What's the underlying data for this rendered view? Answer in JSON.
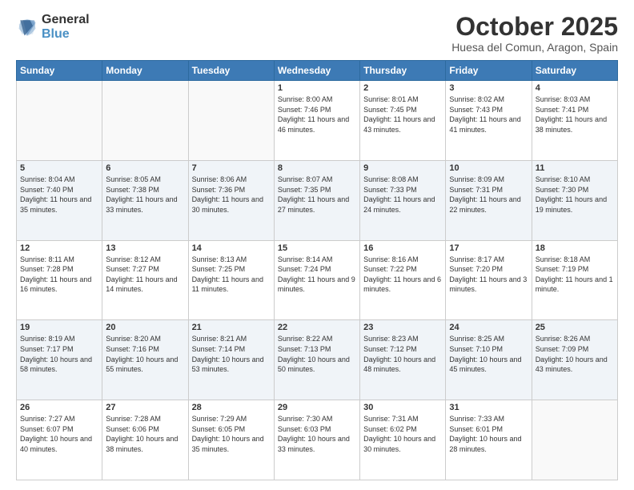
{
  "logo": {
    "general": "General",
    "blue": "Blue"
  },
  "header": {
    "title": "October 2025",
    "subtitle": "Huesa del Comun, Aragon, Spain"
  },
  "weekdays": [
    "Sunday",
    "Monday",
    "Tuesday",
    "Wednesday",
    "Thursday",
    "Friday",
    "Saturday"
  ],
  "weeks": [
    [
      {
        "day": "",
        "sunrise": "",
        "sunset": "",
        "daylight": ""
      },
      {
        "day": "",
        "sunrise": "",
        "sunset": "",
        "daylight": ""
      },
      {
        "day": "",
        "sunrise": "",
        "sunset": "",
        "daylight": ""
      },
      {
        "day": "1",
        "sunrise": "Sunrise: 8:00 AM",
        "sunset": "Sunset: 7:46 PM",
        "daylight": "Daylight: 11 hours and 46 minutes."
      },
      {
        "day": "2",
        "sunrise": "Sunrise: 8:01 AM",
        "sunset": "Sunset: 7:45 PM",
        "daylight": "Daylight: 11 hours and 43 minutes."
      },
      {
        "day": "3",
        "sunrise": "Sunrise: 8:02 AM",
        "sunset": "Sunset: 7:43 PM",
        "daylight": "Daylight: 11 hours and 41 minutes."
      },
      {
        "day": "4",
        "sunrise": "Sunrise: 8:03 AM",
        "sunset": "Sunset: 7:41 PM",
        "daylight": "Daylight: 11 hours and 38 minutes."
      }
    ],
    [
      {
        "day": "5",
        "sunrise": "Sunrise: 8:04 AM",
        "sunset": "Sunset: 7:40 PM",
        "daylight": "Daylight: 11 hours and 35 minutes."
      },
      {
        "day": "6",
        "sunrise": "Sunrise: 8:05 AM",
        "sunset": "Sunset: 7:38 PM",
        "daylight": "Daylight: 11 hours and 33 minutes."
      },
      {
        "day": "7",
        "sunrise": "Sunrise: 8:06 AM",
        "sunset": "Sunset: 7:36 PM",
        "daylight": "Daylight: 11 hours and 30 minutes."
      },
      {
        "day": "8",
        "sunrise": "Sunrise: 8:07 AM",
        "sunset": "Sunset: 7:35 PM",
        "daylight": "Daylight: 11 hours and 27 minutes."
      },
      {
        "day": "9",
        "sunrise": "Sunrise: 8:08 AM",
        "sunset": "Sunset: 7:33 PM",
        "daylight": "Daylight: 11 hours and 24 minutes."
      },
      {
        "day": "10",
        "sunrise": "Sunrise: 8:09 AM",
        "sunset": "Sunset: 7:31 PM",
        "daylight": "Daylight: 11 hours and 22 minutes."
      },
      {
        "day": "11",
        "sunrise": "Sunrise: 8:10 AM",
        "sunset": "Sunset: 7:30 PM",
        "daylight": "Daylight: 11 hours and 19 minutes."
      }
    ],
    [
      {
        "day": "12",
        "sunrise": "Sunrise: 8:11 AM",
        "sunset": "Sunset: 7:28 PM",
        "daylight": "Daylight: 11 hours and 16 minutes."
      },
      {
        "day": "13",
        "sunrise": "Sunrise: 8:12 AM",
        "sunset": "Sunset: 7:27 PM",
        "daylight": "Daylight: 11 hours and 14 minutes."
      },
      {
        "day": "14",
        "sunrise": "Sunrise: 8:13 AM",
        "sunset": "Sunset: 7:25 PM",
        "daylight": "Daylight: 11 hours and 11 minutes."
      },
      {
        "day": "15",
        "sunrise": "Sunrise: 8:14 AM",
        "sunset": "Sunset: 7:24 PM",
        "daylight": "Daylight: 11 hours and 9 minutes."
      },
      {
        "day": "16",
        "sunrise": "Sunrise: 8:16 AM",
        "sunset": "Sunset: 7:22 PM",
        "daylight": "Daylight: 11 hours and 6 minutes."
      },
      {
        "day": "17",
        "sunrise": "Sunrise: 8:17 AM",
        "sunset": "Sunset: 7:20 PM",
        "daylight": "Daylight: 11 hours and 3 minutes."
      },
      {
        "day": "18",
        "sunrise": "Sunrise: 8:18 AM",
        "sunset": "Sunset: 7:19 PM",
        "daylight": "Daylight: 11 hours and 1 minute."
      }
    ],
    [
      {
        "day": "19",
        "sunrise": "Sunrise: 8:19 AM",
        "sunset": "Sunset: 7:17 PM",
        "daylight": "Daylight: 10 hours and 58 minutes."
      },
      {
        "day": "20",
        "sunrise": "Sunrise: 8:20 AM",
        "sunset": "Sunset: 7:16 PM",
        "daylight": "Daylight: 10 hours and 55 minutes."
      },
      {
        "day": "21",
        "sunrise": "Sunrise: 8:21 AM",
        "sunset": "Sunset: 7:14 PM",
        "daylight": "Daylight: 10 hours and 53 minutes."
      },
      {
        "day": "22",
        "sunrise": "Sunrise: 8:22 AM",
        "sunset": "Sunset: 7:13 PM",
        "daylight": "Daylight: 10 hours and 50 minutes."
      },
      {
        "day": "23",
        "sunrise": "Sunrise: 8:23 AM",
        "sunset": "Sunset: 7:12 PM",
        "daylight": "Daylight: 10 hours and 48 minutes."
      },
      {
        "day": "24",
        "sunrise": "Sunrise: 8:25 AM",
        "sunset": "Sunset: 7:10 PM",
        "daylight": "Daylight: 10 hours and 45 minutes."
      },
      {
        "day": "25",
        "sunrise": "Sunrise: 8:26 AM",
        "sunset": "Sunset: 7:09 PM",
        "daylight": "Daylight: 10 hours and 43 minutes."
      }
    ],
    [
      {
        "day": "26",
        "sunrise": "Sunrise: 7:27 AM",
        "sunset": "Sunset: 6:07 PM",
        "daylight": "Daylight: 10 hours and 40 minutes."
      },
      {
        "day": "27",
        "sunrise": "Sunrise: 7:28 AM",
        "sunset": "Sunset: 6:06 PM",
        "daylight": "Daylight: 10 hours and 38 minutes."
      },
      {
        "day": "28",
        "sunrise": "Sunrise: 7:29 AM",
        "sunset": "Sunset: 6:05 PM",
        "daylight": "Daylight: 10 hours and 35 minutes."
      },
      {
        "day": "29",
        "sunrise": "Sunrise: 7:30 AM",
        "sunset": "Sunset: 6:03 PM",
        "daylight": "Daylight: 10 hours and 33 minutes."
      },
      {
        "day": "30",
        "sunrise": "Sunrise: 7:31 AM",
        "sunset": "Sunset: 6:02 PM",
        "daylight": "Daylight: 10 hours and 30 minutes."
      },
      {
        "day": "31",
        "sunrise": "Sunrise: 7:33 AM",
        "sunset": "Sunset: 6:01 PM",
        "daylight": "Daylight: 10 hours and 28 minutes."
      },
      {
        "day": "",
        "sunrise": "",
        "sunset": "",
        "daylight": ""
      }
    ]
  ]
}
